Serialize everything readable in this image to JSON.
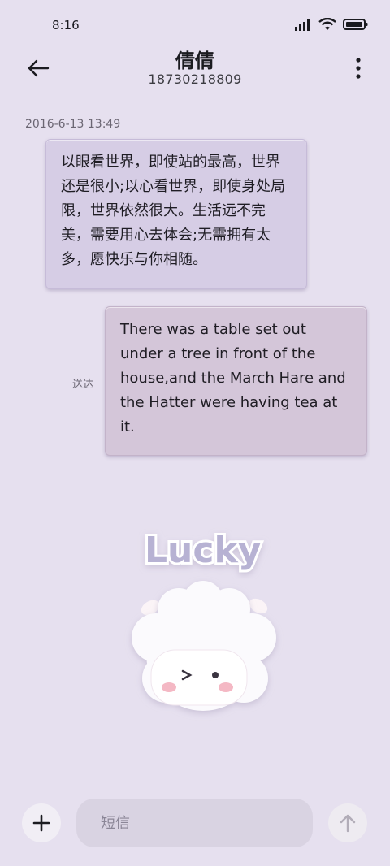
{
  "status": {
    "time": "8:16"
  },
  "header": {
    "contact_name": "倩倩",
    "phone": "18730218809"
  },
  "conversation": {
    "timestamp": "2016-6-13 13:49",
    "messages": [
      {
        "direction": "incoming",
        "text": "以眼看世界，即使站的最高，世界还是很小;以心看世界，即使身处局限，世界依然很大。生活远不完美，需要用心去体会;无需拥有太多，愿快乐与你相随。"
      },
      {
        "direction": "outgoing",
        "text": "There was a table set out under a tree in front of the house,and the March Hare and the Hatter were having tea at it.",
        "status": "送达"
      }
    ]
  },
  "sticker": {
    "text": "Lucky"
  },
  "composer": {
    "placeholder": "短信"
  },
  "colors": {
    "background": "#e6e0ef",
    "incoming_bubble": "#d6cde5",
    "outgoing_bubble": "#d4c6d9"
  }
}
